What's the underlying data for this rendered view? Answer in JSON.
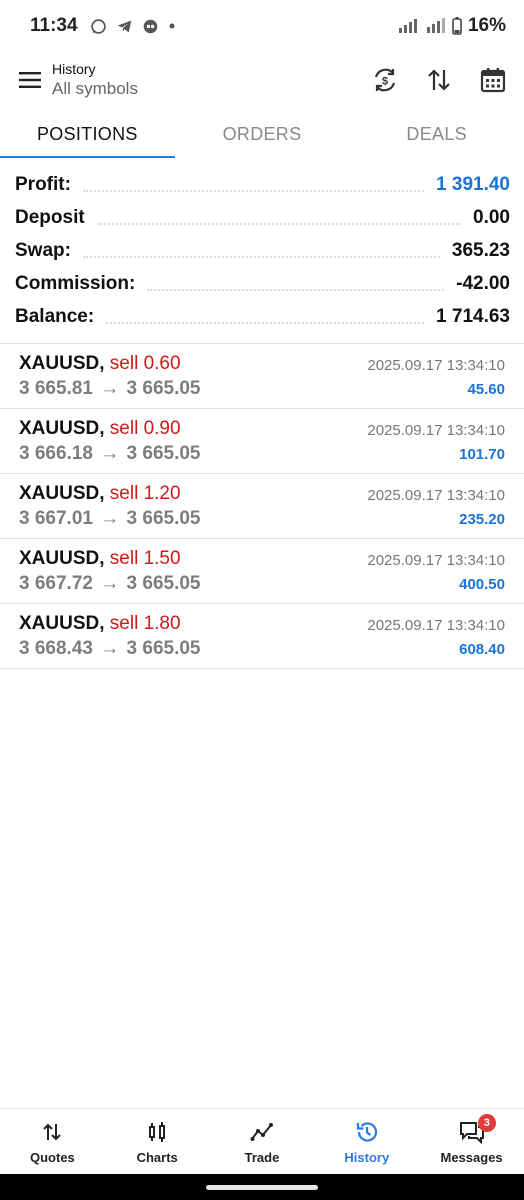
{
  "status": {
    "time": "11:34",
    "battery": "16%",
    "left_icons": [
      "whatsapp-icon",
      "telegram-icon",
      "app-icon",
      "dot-icon"
    ],
    "right_icons": [
      "signal-icon",
      "wifi-4g-icon",
      "battery-icon"
    ]
  },
  "header": {
    "title": "History",
    "subtitle": "All symbols",
    "actions": [
      "swap-currency-icon",
      "sort-icon",
      "calendar-icon"
    ]
  },
  "tabs": [
    {
      "label": "POSITIONS",
      "active": true
    },
    {
      "label": "ORDERS",
      "active": false
    },
    {
      "label": "DEALS",
      "active": false
    }
  ],
  "summary": {
    "profit_label": "Profit:",
    "profit_value": "1 391.40",
    "deposit_label": "Deposit",
    "deposit_value": "0.00",
    "swap_label": "Swap:",
    "swap_value": "365.23",
    "commission_label": "Commission:",
    "commission_value": "-42.00",
    "balance_label": "Balance:",
    "balance_value": "1 714.63"
  },
  "positions": [
    {
      "symbol": "XAUUSD,",
      "side": "sell 0.60",
      "open": "3 665.81",
      "arrow": "→",
      "close": "3 665.05",
      "time": "2025.09.17 13:34:10",
      "profit": "45.60"
    },
    {
      "symbol": "XAUUSD,",
      "side": "sell 0.90",
      "open": "3 666.18",
      "arrow": "→",
      "close": "3 665.05",
      "time": "2025.09.17 13:34:10",
      "profit": "101.70"
    },
    {
      "symbol": "XAUUSD,",
      "side": "sell 1.20",
      "open": "3 667.01",
      "arrow": "→",
      "close": "3 665.05",
      "time": "2025.09.17 13:34:10",
      "profit": "235.20"
    },
    {
      "symbol": "XAUUSD,",
      "side": "sell 1.50",
      "open": "3 667.72",
      "arrow": "→",
      "close": "3 665.05",
      "time": "2025.09.17 13:34:10",
      "profit": "400.50"
    },
    {
      "symbol": "XAUUSD,",
      "side": "sell 1.80",
      "open": "3 668.43",
      "arrow": "→",
      "close": "3 665.05",
      "time": "2025.09.17 13:34:10",
      "profit": "608.40"
    }
  ],
  "nav": [
    {
      "label": "Quotes",
      "icon": "quotes-icon"
    },
    {
      "label": "Charts",
      "icon": "charts-icon"
    },
    {
      "label": "Trade",
      "icon": "trade-icon"
    },
    {
      "label": "History",
      "icon": "history-icon",
      "active": true
    },
    {
      "label": "Messages",
      "icon": "messages-icon",
      "badge": "3"
    }
  ],
  "colors": {
    "accent": "#2b7be0",
    "profit_blue": "#1a73d9",
    "sell_red": "#d01818"
  }
}
